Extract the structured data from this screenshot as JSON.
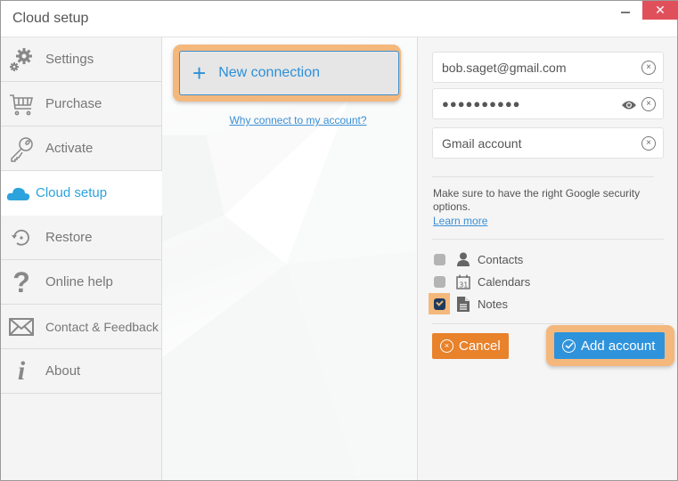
{
  "window": {
    "title": "Cloud setup",
    "minimize_label": "",
    "close_label": "✕"
  },
  "sidebar": {
    "items": [
      {
        "label": "Settings",
        "icon": "gears-icon"
      },
      {
        "label": "Purchase",
        "icon": "cart-icon"
      },
      {
        "label": "Activate",
        "icon": "key-icon"
      },
      {
        "label": "Cloud setup",
        "icon": "cloud-icon",
        "active": true
      },
      {
        "label": "Restore",
        "icon": "restore-icon"
      },
      {
        "label": "Online help",
        "icon": "question-icon"
      },
      {
        "label": "Contact & Feedback",
        "icon": "envelope-icon"
      },
      {
        "label": "About",
        "icon": "info-icon"
      }
    ]
  },
  "middle": {
    "new_connection_icon": "+",
    "new_connection_label": "New connection",
    "why_link": "Why connect to my account?"
  },
  "form": {
    "email_value": "bob.saget@gmail.com",
    "password_value": "●●●●●●●●●●",
    "account_name_value": "Gmail account",
    "clear_glyph": "×",
    "hint": "Make sure to have the right Google security options.",
    "learn_more": "Learn more",
    "options": [
      {
        "label": "Contacts",
        "checked": false,
        "icon": "person-icon"
      },
      {
        "label": "Calendars",
        "checked": false,
        "icon": "calendar-icon"
      },
      {
        "label": "Notes",
        "checked": true,
        "icon": "document-icon"
      }
    ],
    "cancel_label": "Cancel",
    "cancel_glyph": "×",
    "add_label": "Add account"
  },
  "colors": {
    "accent_blue": "#2f93dc",
    "cancel_orange": "#e8822b",
    "focus_ring": "#f4b87c",
    "close_red": "#e0505b"
  }
}
